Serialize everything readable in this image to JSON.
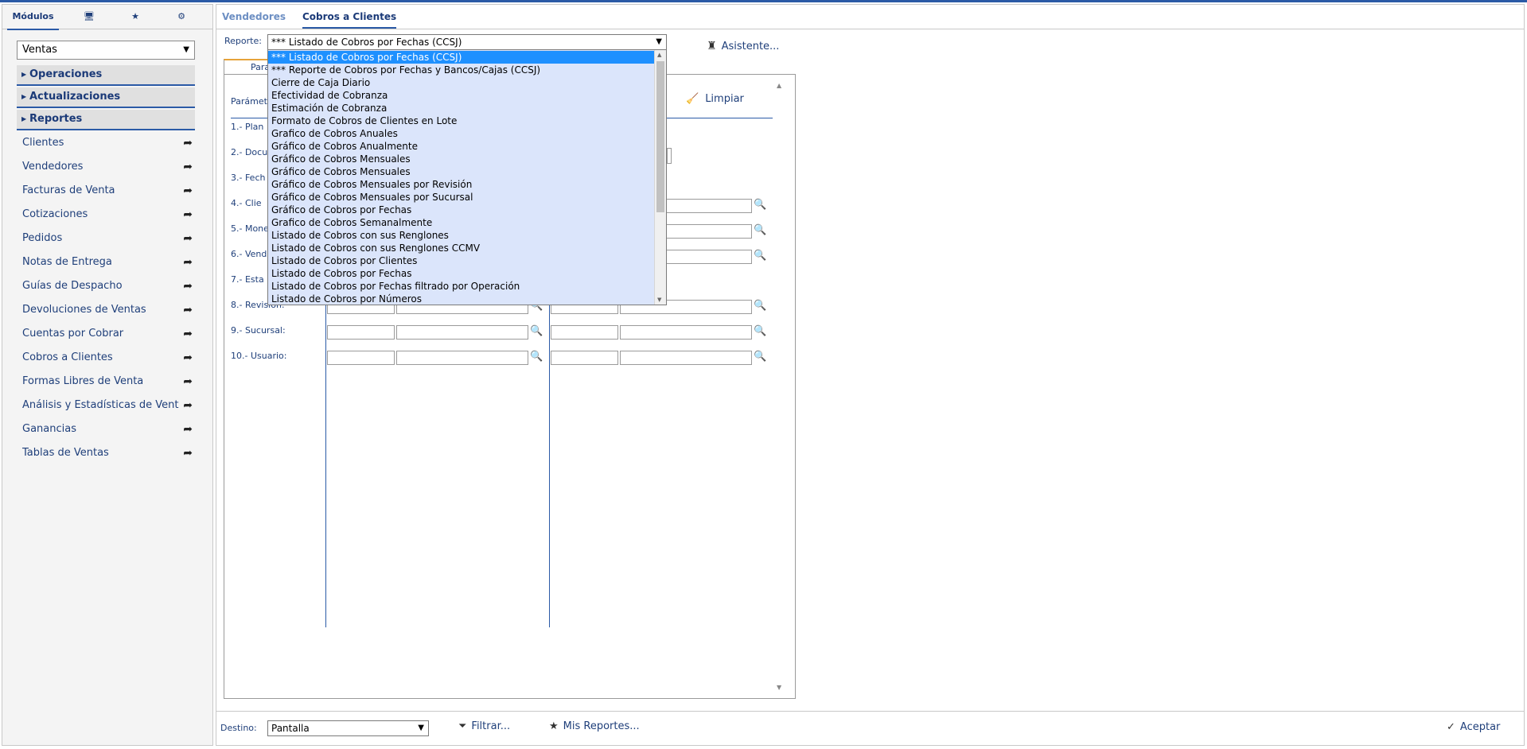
{
  "sidebar": {
    "tabs": [
      {
        "label": "Módulos",
        "icon": "modules-tab"
      },
      {
        "label": "",
        "icon": "monitor-icon"
      },
      {
        "label": "",
        "icon": "star-icon"
      },
      {
        "label": "",
        "icon": "gears-icon"
      }
    ],
    "module_select": "Ventas",
    "sections": [
      "Operaciones",
      "Actualizaciones",
      "Reportes"
    ],
    "items": [
      "Clientes",
      "Vendedores",
      "Facturas de Venta",
      "Cotizaciones",
      "Pedidos",
      "Notas de Entrega",
      "Guías de Despacho",
      "Devoluciones de Ventas",
      "Cuentas por Cobrar",
      "Cobros a Clientes",
      "Formas Libres de Venta",
      "Análisis y Estadísticas de Vent",
      "Ganancias",
      "Tablas de Ventas"
    ]
  },
  "main": {
    "tabs": [
      "Vendedores",
      "Cobros a Clientes"
    ],
    "report_label": "Reporte:",
    "report_selected": "*** Listado de Cobros por Fechas (CCSJ)",
    "asistente": "Asistente...",
    "panel_tab": "Para",
    "param_header": "Parámet",
    "limpiar": "Limpiar",
    "rows": [
      "1.- Plan",
      "2.- Docu",
      "3.- Fech",
      "4.- Clie",
      "5.- Mone",
      "6.- Vend",
      "7.- Esta",
      "8.- Revisión:",
      "9.- Sucursal:",
      "10.- Usuario:"
    ],
    "dropdown_options": [
      "*** Listado de Cobros por Fechas (CCSJ)",
      "*** Reporte de Cobros por Fechas y Bancos/Cajas (CCSJ)",
      "Cierre de Caja Diario",
      "Efectividad de Cobranza",
      "Estimación de Cobranza",
      "Formato de Cobros de Clientes en Lote",
      "Grafico de Cobros Anuales",
      "Gráfico de Cobros Anualmente",
      "Gráfico de Cobros Mensuales",
      "Gráfico de Cobros Mensuales",
      "Gráfico de Cobros Mensuales por Revisión",
      "Gráfico de Cobros Mensuales por Sucursal",
      "Gráfico de Cobros por Fechas",
      "Grafico de Cobros Semanalmente",
      "Listado de Cobros con sus Renglones",
      "Listado de Cobros con sus Renglones CCMV",
      "Listado de Cobros por Clientes",
      "Listado de Cobros por Fechas",
      "Listado de Cobros por Fechas filtrado por Operación",
      "Listado de Cobros por Números"
    ]
  },
  "bottom": {
    "destino_label": "Destino:",
    "destino_value": "Pantalla",
    "filtrar": "Filtrar...",
    "mis_reportes": "Mis Reportes...",
    "aceptar": "Aceptar"
  }
}
